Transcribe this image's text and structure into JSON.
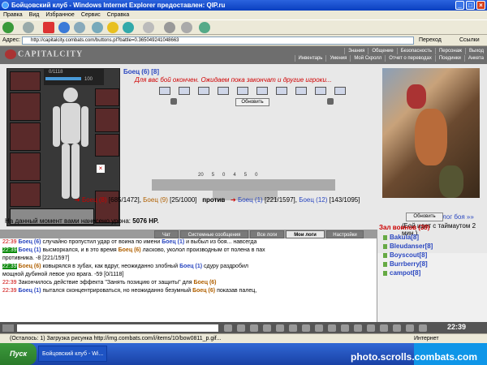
{
  "window": {
    "title": "Бойцовский клуб - Windows Internet Explorer предоставлен: QIP.ru"
  },
  "menu": [
    "Правка",
    "Вид",
    "Избранное",
    "Сервис",
    "Справка"
  ],
  "address": {
    "label": "Адрес:",
    "url": "http://capitalcity.combats.com/buttons.pl?battle=0.365049241048663",
    "go": "Переход",
    "links": "Ссылки"
  },
  "game": {
    "logo": "CAPITALCITY",
    "nav_top": [
      "Знания",
      "Общение",
      "Безопасность",
      "Персонаж",
      "Выход"
    ],
    "nav_bottom": [
      "Инвентарь",
      "Умения",
      "Мой Скролл",
      "Отчет о переводах",
      "Поединки",
      "Анкета"
    ],
    "hp": "0/1118",
    "ammo": "100",
    "fighter_title": "Боец (6) [8]",
    "waiting": "Для вас бой окончен. Ожидаем пока закончат и другие игроки...",
    "update_btn": "Обновить",
    "stats": [
      "20",
      "5",
      "0",
      "4",
      "5",
      "0"
    ],
    "team1": [
      {
        "name": "Боец (8)",
        "hp": "[685/1472]"
      },
      {
        "name": "Боец (9)",
        "hp": "[25/1000]"
      }
    ],
    "vs": "против",
    "team2": [
      {
        "name": "Боец (1)",
        "hp": "[221/1597]"
      },
      {
        "name": "Боец (12)",
        "hp": "[143/1095]"
      }
    ],
    "damage_label": "На данный момент вами нанесено урона:",
    "damage_value": "5076 HP.",
    "log_link": "лог боя »»",
    "timeout": "(Бой идет с таймаутом 2 мин.)"
  },
  "tabs": [
    "Чат",
    "Системные сообщения",
    "Все логи",
    "Мои логи",
    "Настройки"
  ],
  "chat": [
    {
      "t": "22:39",
      "a": "Боец (6)",
      "txt": " случайно пропустил удар от воина по имени ",
      "b": "Боец (1)",
      "txt2": " и выбыл из боя... навсегда"
    },
    {
      "t": "22:39",
      "a": "Боец (1)",
      "txt": " высморкался, и в это время ",
      "b": "Боец (6)",
      "txt2": " ласково, уколол производным от полена в пах"
    },
    {
      "t": "",
      "a": "",
      "txt": "противника. -8 [221/1597]",
      "b": "",
      "txt2": ""
    },
    {
      "t": "22:39",
      "a": "Боец (6)",
      "txt": " ковырялся в зубах, как вдруг, неожиданно злобный ",
      "b": "Боец (1)",
      "txt2": " сдуру раздробил"
    },
    {
      "t": "",
      "a": "",
      "txt": "мощной дубиной левое ухо врага. -59 [0/1118]",
      "b": "",
      "txt2": ""
    },
    {
      "t": "22:39",
      "a": "",
      "txt": "Закончилось действие эффекта \"Занять позицию от защиты\" для ",
      "b": "Боец (6)",
      "txt2": ""
    },
    {
      "t": "22:39",
      "a": "Боец (1)",
      "txt": " пытался сконцентрироваться, но неожиданно безумный ",
      "b": "Боец (6)",
      "txt2": " показав палец,"
    }
  ],
  "right": {
    "update": "Обновить",
    "hall": "Зал воинов (39)",
    "players": [
      "Bakula[8]",
      "Bleudanser[8]",
      "Boyscout[8]",
      "Burrberry[8]",
      "campot[8]"
    ]
  },
  "clock": "22:39",
  "status": "(Осталось: 1) Загрузка рисунка http://img.combats.com/i/items/10/bow0811_p.gif...",
  "zone": "Интернет",
  "taskbar": {
    "start": "Пуск",
    "task": "Бойцовский клуб - Wi..."
  },
  "watermark": "photo.scrolls.combats.com"
}
